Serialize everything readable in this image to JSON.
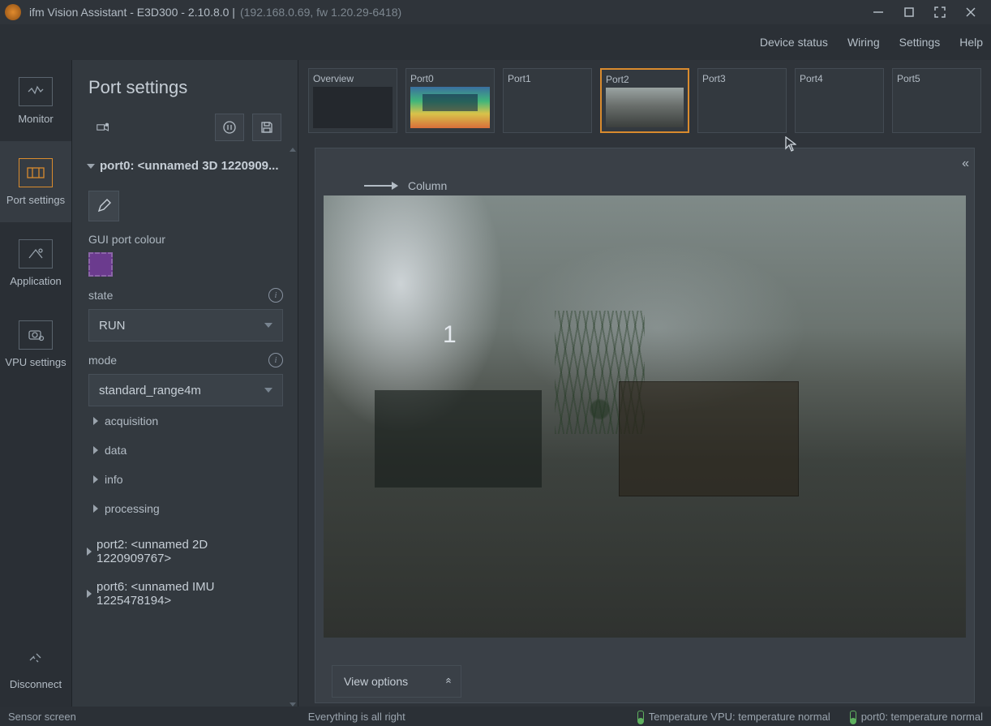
{
  "title": {
    "app": "ifm Vision Assistant - E3D300 - 2.10.8.0 |",
    "conn": "(192.168.0.69, fw 1.20.29-6418)"
  },
  "topmenu": [
    "Device status",
    "Wiring",
    "Settings",
    "Help"
  ],
  "rail": {
    "monitor": "Monitor",
    "port_settings": "Port settings",
    "application": "Application",
    "vpu_settings": "VPU settings",
    "disconnect": "Disconnect"
  },
  "panel": {
    "title": "Port settings",
    "port0_head": "port0: <unnamed 3D 1220909...",
    "gui_colour_label": "GUI port colour",
    "state_label": "state",
    "state_value": "RUN",
    "mode_label": "mode",
    "mode_value": "standard_range4m",
    "sub": {
      "acq": "acquisition",
      "data": "data",
      "info": "info",
      "proc": "processing"
    },
    "port2_head": "port2: <unnamed 2D 1220909767>",
    "port6_head": "port6: <unnamed IMU 1225478194>"
  },
  "thumbs": [
    "Overview",
    "Port0",
    "Port1",
    "Port2",
    "Port3",
    "Port4",
    "Port5"
  ],
  "viewer": {
    "column_label": "Column",
    "overlay_number": "1",
    "view_options": "View options"
  },
  "status": {
    "left": "Sensor screen",
    "center": "Everything is all right",
    "t1": "Temperature VPU: temperature normal",
    "t2": "port0: temperature normal"
  }
}
